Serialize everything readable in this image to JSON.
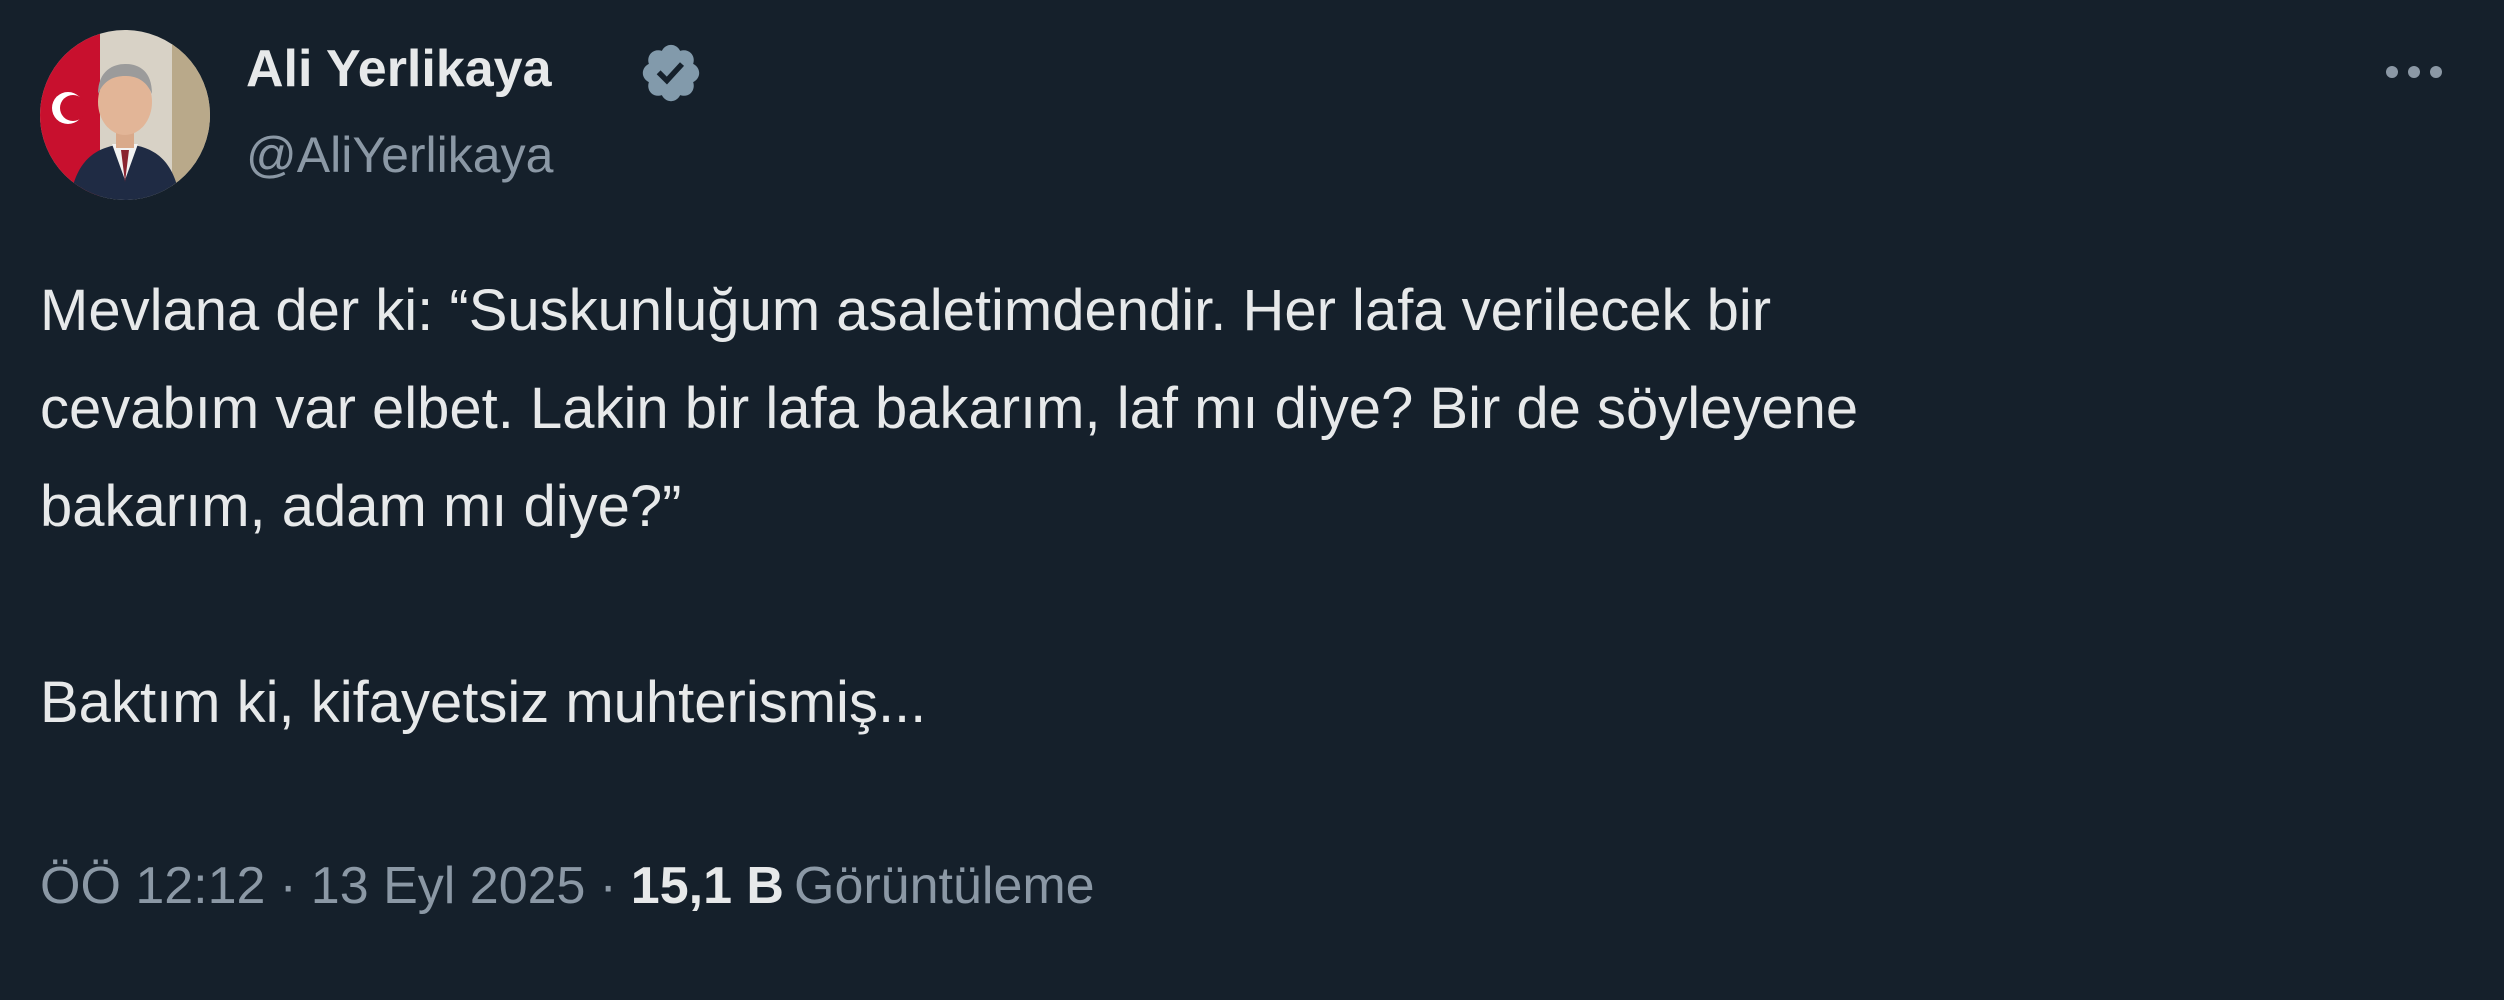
{
  "author": {
    "display_name": "Ali Yerlikaya",
    "handle": "@AliYerlikaya",
    "verified": true
  },
  "tweet": {
    "lines": [
      "Mevlana der ki: “Suskunluğum asaletimdendir. Her lafa verilecek bir",
      "cevabım var elbet. Lakin bir lafa bakarım, laf mı diye? Bir de söyleyene",
      "bakarım, adam mı diye?”",
      "Baktım ki, kifayetsiz muhterismiş..."
    ]
  },
  "meta": {
    "time": "ÖÖ 12:12",
    "separator": "·",
    "date": "13 Eyl 2025",
    "views_count": "15,1 B",
    "views_label": "Görüntüleme"
  },
  "colors": {
    "background": "#15202b",
    "text": "#e7e9ea",
    "secondary": "#8b98a5",
    "verified_badge": "#829aab"
  },
  "icons": {
    "verified": "verified-badge-icon",
    "more": "more-options-icon"
  }
}
